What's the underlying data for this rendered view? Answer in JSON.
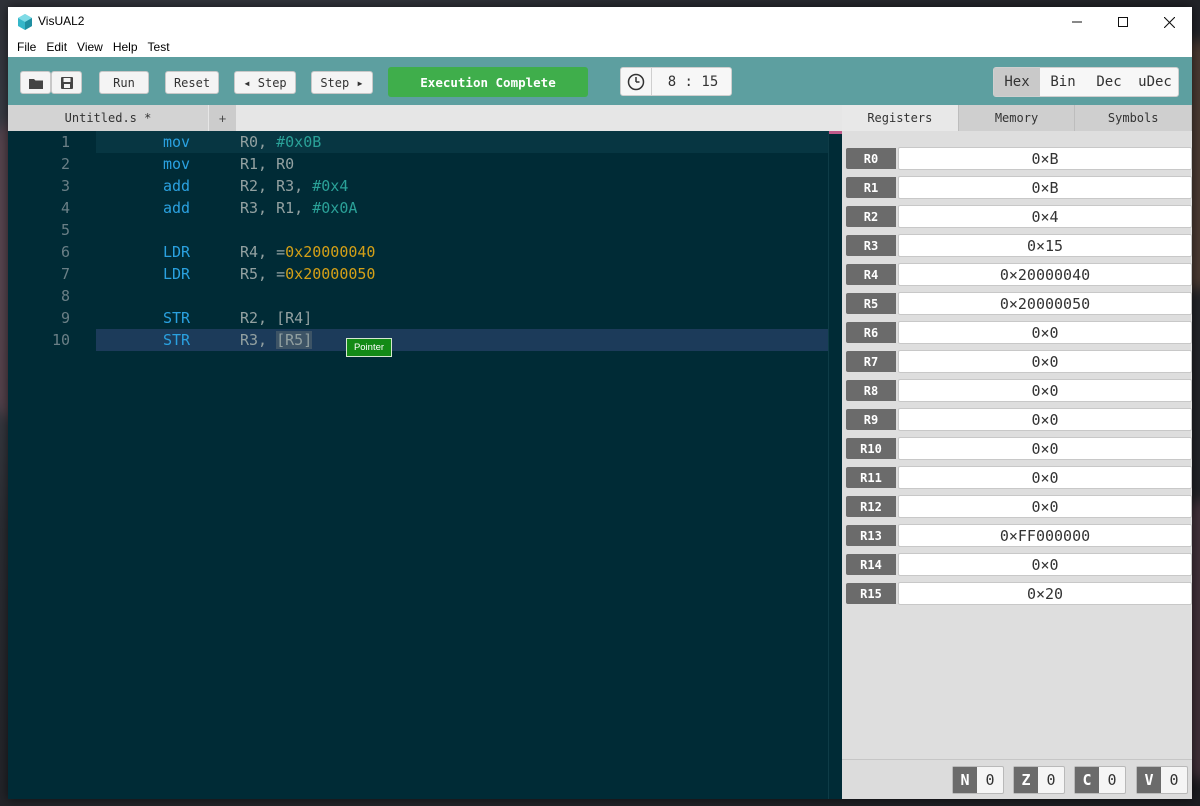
{
  "window": {
    "title": "VisUAL2"
  },
  "menu": [
    "File",
    "Edit",
    "View",
    "Help",
    "Test"
  ],
  "toolbar": {
    "run_label": "Run",
    "reset_label": "Reset",
    "step_back_label": "◂ Step",
    "step_fwd_label": "Step ▸",
    "status": "Execution Complete",
    "clock": "8 : 15",
    "radix": [
      "Hex",
      "Bin",
      "Dec",
      "uDec"
    ],
    "radix_active": "Hex"
  },
  "editor": {
    "tab_label": "Untitled.s *",
    "add_tab_label": "+",
    "pointer_tag": "Pointer",
    "lines": [
      {
        "num": "1",
        "op": "mov",
        "args": [
          {
            "t": "R0, ",
            "c": "plain"
          },
          {
            "t": "#0x0B",
            "c": "imm"
          }
        ]
      },
      {
        "num": "2",
        "op": "mov",
        "args": [
          {
            "t": "R1, R0",
            "c": "plain"
          }
        ]
      },
      {
        "num": "3",
        "op": "add",
        "args": [
          {
            "t": "R2, R3, ",
            "c": "plain"
          },
          {
            "t": "#0x4",
            "c": "imm"
          }
        ]
      },
      {
        "num": "4",
        "op": "add",
        "args": [
          {
            "t": "R3, R1, ",
            "c": "plain"
          },
          {
            "t": "#0x0A",
            "c": "imm"
          }
        ]
      },
      {
        "num": "5",
        "op": "",
        "args": []
      },
      {
        "num": "6",
        "op": "LDR",
        "args": [
          {
            "t": "R4, =",
            "c": "plain"
          },
          {
            "t": "0x20000040",
            "c": "lit"
          }
        ]
      },
      {
        "num": "7",
        "op": "LDR",
        "args": [
          {
            "t": "R5, =",
            "c": "plain"
          },
          {
            "t": "0x20000050",
            "c": "lit"
          }
        ]
      },
      {
        "num": "8",
        "op": "",
        "args": []
      },
      {
        "num": "9",
        "op": "STR",
        "args": [
          {
            "t": "R2, [R4]",
            "c": "plain"
          }
        ]
      },
      {
        "num": "10",
        "op": "STR",
        "args": [
          {
            "t": "R3, ",
            "c": "plain"
          },
          {
            "t": "[R5]",
            "c": "sel"
          }
        ]
      }
    ]
  },
  "right_panel": {
    "tabs": [
      "Registers",
      "Memory",
      "Symbols"
    ],
    "active_tab": "Registers",
    "registers": [
      {
        "name": "R0",
        "value": "0×B"
      },
      {
        "name": "R1",
        "value": "0×B"
      },
      {
        "name": "R2",
        "value": "0×4"
      },
      {
        "name": "R3",
        "value": "0×15"
      },
      {
        "name": "R4",
        "value": "0×20000040"
      },
      {
        "name": "R5",
        "value": "0×20000050"
      },
      {
        "name": "R6",
        "value": "0×0"
      },
      {
        "name": "R7",
        "value": "0×0"
      },
      {
        "name": "R8",
        "value": "0×0"
      },
      {
        "name": "R9",
        "value": "0×0"
      },
      {
        "name": "R10",
        "value": "0×0"
      },
      {
        "name": "R11",
        "value": "0×0"
      },
      {
        "name": "R12",
        "value": "0×0"
      },
      {
        "name": "R13",
        "value": "0×FF000000"
      },
      {
        "name": "R14",
        "value": "0×0"
      },
      {
        "name": "R15",
        "value": "0×20"
      }
    ],
    "flags": [
      {
        "name": "N",
        "value": "0"
      },
      {
        "name": "Z",
        "value": "0"
      },
      {
        "name": "C",
        "value": "0"
      },
      {
        "name": "V",
        "value": "0"
      }
    ]
  },
  "colors": {
    "toolbar_bg": "#5d9fa0",
    "editor_bg": "#002b36",
    "status_green": "#3fae4b",
    "keyword": "#2aa1e0",
    "immediate": "#2aa198",
    "literal": "#d4a017"
  }
}
